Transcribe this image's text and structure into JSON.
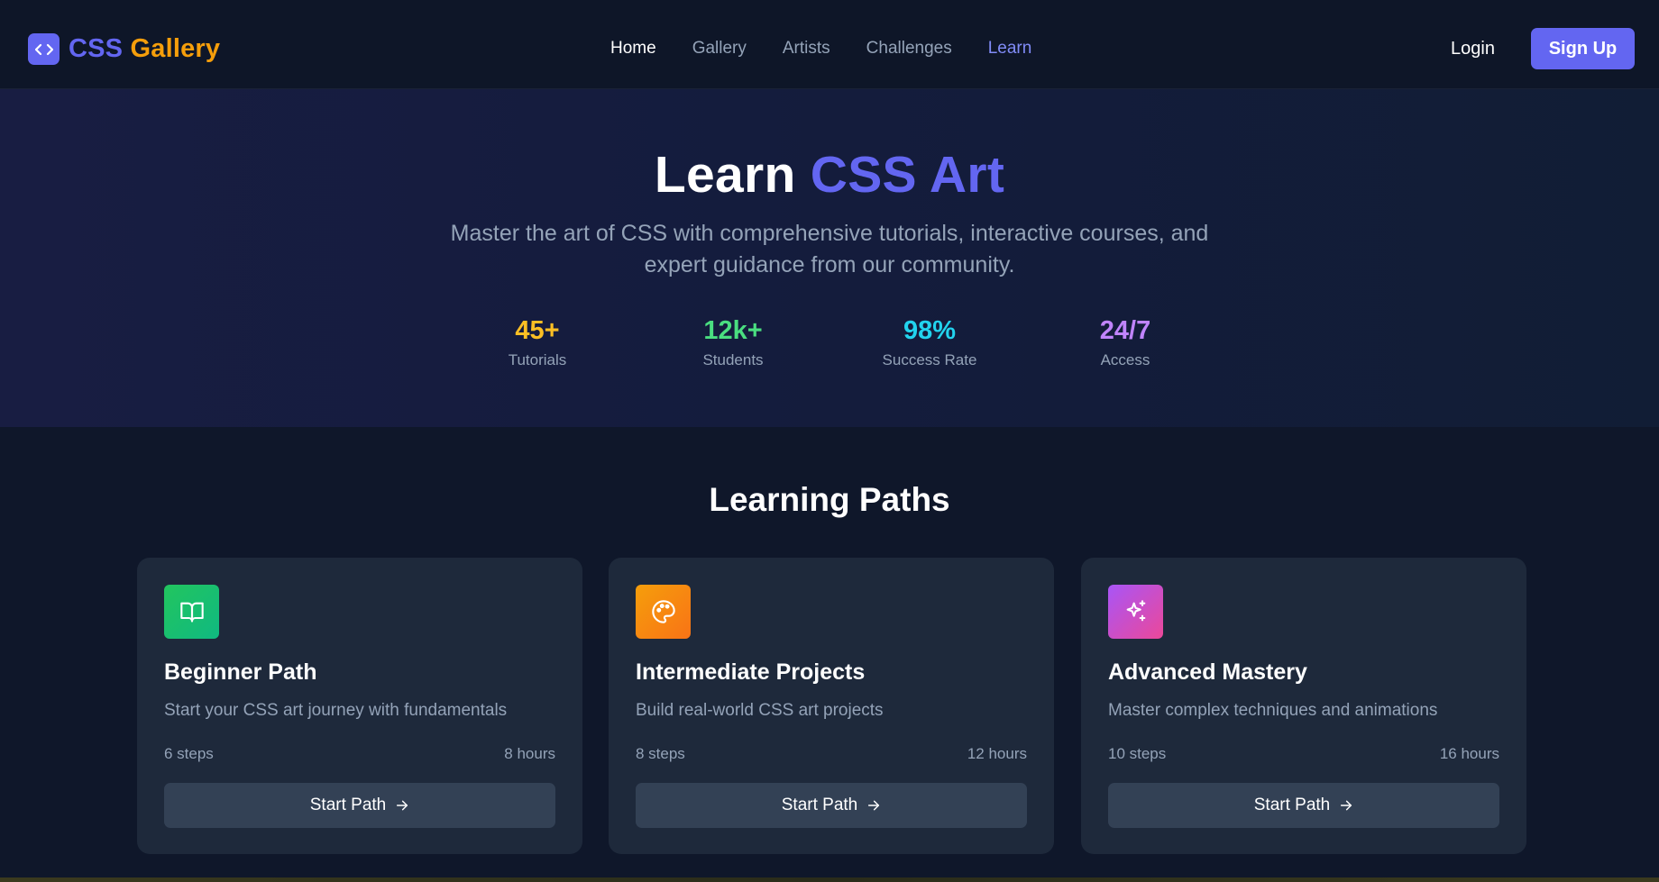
{
  "brand": {
    "part1": "CSS",
    "part2": "Gallery",
    "icon": "code-brackets-icon"
  },
  "nav": {
    "links": [
      {
        "label": "Home"
      },
      {
        "label": "Gallery"
      },
      {
        "label": "Artists"
      },
      {
        "label": "Challenges"
      },
      {
        "label": "Learn"
      }
    ],
    "login_label": "Login",
    "signup_label": "Sign Up"
  },
  "hero": {
    "title_main": "Learn",
    "title_accent": "CSS Art",
    "subtitle": "Master the art of CSS with comprehensive tutorials, interactive courses, and expert guidance from our community.",
    "stats": [
      {
        "value": "45+",
        "label": "Tutorials",
        "color": "#fbbf24"
      },
      {
        "value": "12k+",
        "label": "Students",
        "color": "#4ade80"
      },
      {
        "value": "98%",
        "label": "Success Rate",
        "color": "#22d3ee"
      },
      {
        "value": "24/7",
        "label": "Access",
        "color": "#c084fc"
      }
    ]
  },
  "paths": {
    "section_title": "Learning Paths",
    "cards": [
      {
        "title": "Beginner Path",
        "description": "Start your CSS art journey with fundamentals",
        "steps": "6 steps",
        "hours": "8 hours",
        "button": "Start Path",
        "icon": "book-open-icon"
      },
      {
        "title": "Intermediate Projects",
        "description": "Build real-world CSS art projects",
        "steps": "8 steps",
        "hours": "12 hours",
        "button": "Start Path",
        "icon": "palette-icon"
      },
      {
        "title": "Advanced Mastery",
        "description": "Master complex techniques and animations",
        "steps": "10 steps",
        "hours": "16 hours",
        "button": "Start Path",
        "icon": "sparkles-icon"
      }
    ]
  },
  "colors": {
    "accent": "#6366f1",
    "brand_secondary": "#f59e0b",
    "background": "#0f172a",
    "card": "#1e293b"
  }
}
